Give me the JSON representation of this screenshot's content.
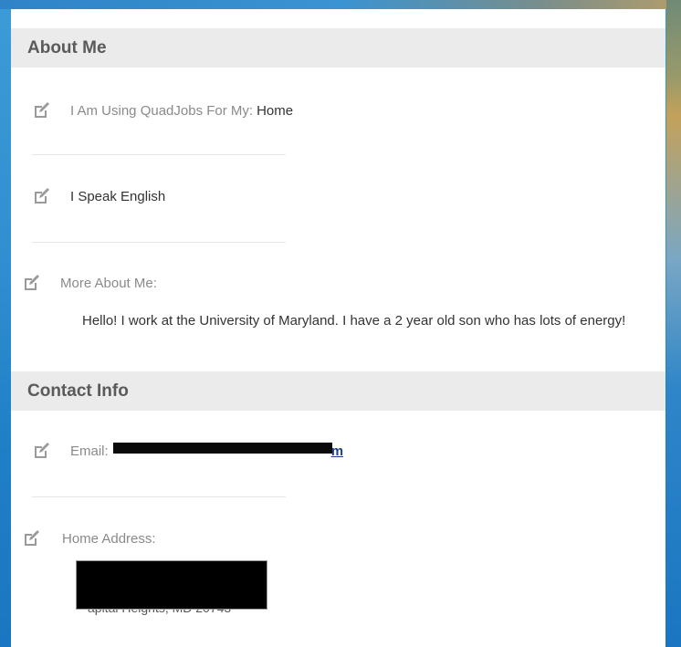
{
  "about": {
    "header": "About Me",
    "using_label": "I Am Using QuadJobs For My:",
    "using_value": "Home",
    "language_label": "I Speak English",
    "more_label": "More About Me:",
    "more_text": "Hello! I work at the University of Maryland. I have a 2 year old son who has lots of energy!"
  },
  "contact": {
    "header": "Contact Info",
    "email_label": "Email:",
    "email_value_visible": "m",
    "address_label": "Home Address:",
    "address_partial": "apital Heights, MD 20743"
  },
  "icons": {
    "edit": "edit-pencil-icon"
  },
  "colors": {
    "page_bg": "#2f8fd0",
    "header_bg": "#ebebeb",
    "link": "#1b3f8f"
  }
}
